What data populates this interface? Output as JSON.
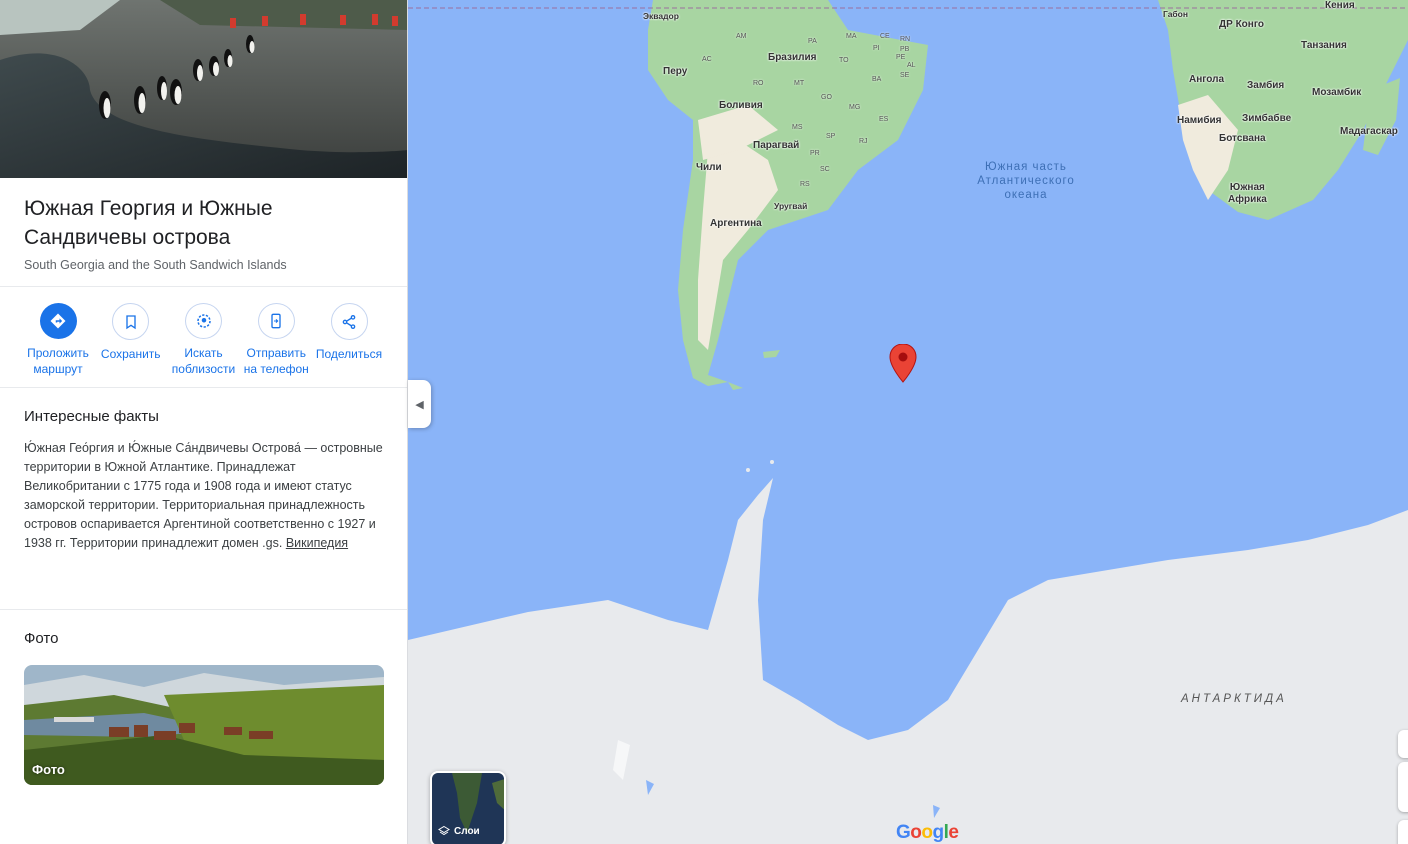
{
  "place": {
    "title": "Южная Георгия и Южные Сандвичевы острова",
    "subtitle": "South Georgia and the South Sandwich Islands"
  },
  "actions": [
    {
      "label": "Проложить\nмаршрут",
      "icon": "directions-icon"
    },
    {
      "label": "Сохранить",
      "icon": "bookmark-icon"
    },
    {
      "label": "Искать\nпоблизости",
      "icon": "nearby-icon"
    },
    {
      "label": "Отправить\nна телефон",
      "icon": "phone-icon"
    },
    {
      "label": "Поделиться",
      "icon": "share-icon"
    }
  ],
  "facts": {
    "title": "Интересные факты",
    "text": "Ю́жная Гео́ргия и Ю́жные Са́ндвичевы Острова́ — островные территории в Южной Атлантике. Принадлежат Великобритании с 1775 года и 1908 года и имеют статус заморской территории. Территориальная принадлежность островов оспаривается Аргентиной соответственно с 1927 и 1938 гг. Территории принадлежит домен .gs. ",
    "link": "Википедия"
  },
  "photos": {
    "title": "Фото",
    "card_label": "Фото"
  },
  "map": {
    "ocean_label": "Южная часть\nАтлантического\nокеана",
    "antarctica": "АНТАРКТИДА",
    "countries": [
      "Эквадор",
      "Перу",
      "Бразилия",
      "Боливия",
      "Парагвай",
      "Чили",
      "Уругвай",
      "Аргентина",
      "Кения",
      "Габон",
      "ДР Конго",
      "Танзания",
      "Ангола",
      "Замбия",
      "Мозамбик",
      "Намибия",
      "Зимбабве",
      "Ботсвана",
      "Мадагаскар",
      "Южная\nАфрика"
    ],
    "states": [
      "AM",
      "PA",
      "MA",
      "CE",
      "RN",
      "PB",
      "AC",
      "RO",
      "PI",
      "PE",
      "AL",
      "TO",
      "BA",
      "SE",
      "MT",
      "GO",
      "MG",
      "ES",
      "MS",
      "SP",
      "RJ",
      "PR",
      "SC",
      "RS"
    ],
    "layers_label": "Слои",
    "logo": "Google",
    "colors": {
      "water": "#8ab4f8",
      "land": "#a8d5a2",
      "dry_land": "#f0ebdd",
      "ice": "#e8eaed",
      "marker": "#ea4335",
      "accent": "#1a73e8"
    }
  }
}
